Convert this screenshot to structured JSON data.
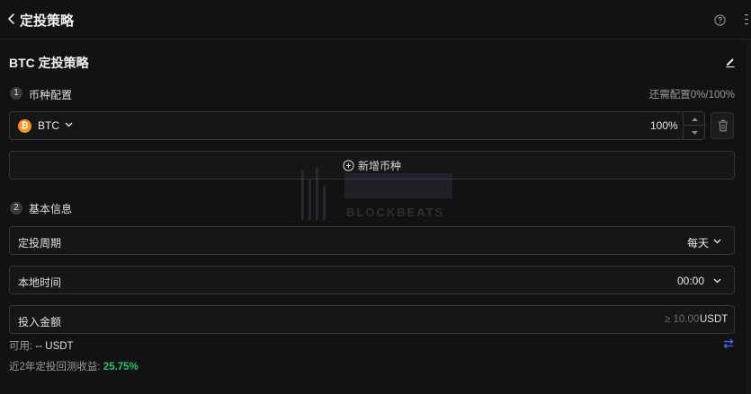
{
  "header": {
    "title": "定投策略",
    "back_icon": "chevron-left-icon",
    "help_icon": "question-circle-icon",
    "menu_icon": "more-vertical-icon"
  },
  "strategy": {
    "name": "BTC 定投策略",
    "edit_icon": "edit-pencil-icon"
  },
  "section1": {
    "step": "1",
    "label": "币种配置",
    "remaining": "还需配置0%/100%"
  },
  "coin": {
    "symbol": "BTC",
    "icon_glyph": "₿",
    "icon_color": "#f7931a",
    "percent": "100%"
  },
  "add_coin": {
    "label": "新增币种",
    "icon": "plus-circle-icon"
  },
  "section2": {
    "step": "2",
    "label": "基本信息"
  },
  "fields": {
    "period": {
      "label": "定投周期",
      "value": "每天"
    },
    "time": {
      "label": "本地时间",
      "value": "00:00"
    },
    "amount": {
      "label": "投入金额",
      "placeholder": "≥ 10.00",
      "unit": "USDT"
    }
  },
  "available": {
    "label": "可用:",
    "value": "-- USDT"
  },
  "backtest": {
    "label": "近2年定投回测收益:",
    "value": "25.75%",
    "color": "#2fbf71"
  },
  "watermark": {
    "text": "BLOCKBEATS"
  }
}
